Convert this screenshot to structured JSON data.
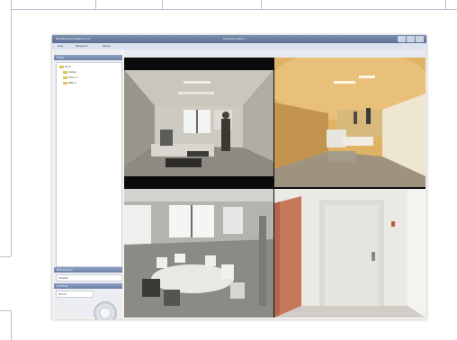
{
  "window": {
    "title": "Windows Surveillance 7.0",
    "center_title": "Grouping View 1",
    "buttons": [
      "minimize",
      "maximize",
      "close"
    ]
  },
  "menu": {
    "items": [
      "Live",
      "Playback",
      "Setup"
    ]
  },
  "sidebar": {
    "tree_panel_title": "Views",
    "tree_items": [
      "Root",
      "Lobby",
      "Floor 2",
      "Office"
    ],
    "ptz_panel_title": "PTZ Control",
    "preset_label": "Presets",
    "control_panel_title": "Controls",
    "zoom_label": "Zoom"
  },
  "cameras": [
    {
      "id": "cam-1",
      "view": "office-overview"
    },
    {
      "id": "cam-2",
      "view": "fisheye-corridor"
    },
    {
      "id": "cam-3",
      "view": "meeting-room"
    },
    {
      "id": "cam-4",
      "view": "doorway"
    }
  ],
  "colors": {
    "titlebar": "#6d80a8",
    "panel_header": "#7d8fb4",
    "tree_folder": "#e3c35b"
  }
}
